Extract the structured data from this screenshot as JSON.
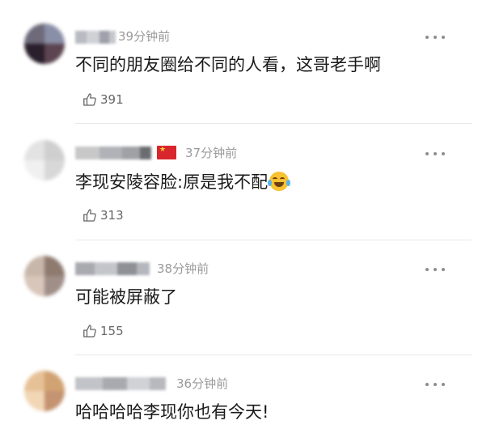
{
  "comments": [
    {
      "time": "39分钟前",
      "text": "不同的朋友圈给不同的人看，这哥老手啊",
      "likes": "391",
      "has_flag": false,
      "has_emoji": false,
      "avatar_colors": [
        "#6e6a7a",
        "#8a8fa8",
        "#2a1f2c",
        "#5c4550"
      ],
      "username_colors": [
        "#b9bbc2",
        "#cfd1d6",
        "#9ea1aa",
        "#c5c7cc"
      ]
    },
    {
      "time": "37分钟前",
      "text": "李现安陵容脸:原是我不配",
      "likes": "313",
      "has_flag": true,
      "has_emoji": true,
      "emoji_name": "tears-of-joy-emoji",
      "avatar_colors": [
        "#e3e3e3",
        "#cfcfcf",
        "#f0f0f0",
        "#d8d8d8"
      ],
      "username_colors": [
        "#c8c8c8",
        "#b0b2b8",
        "#9fa1a6",
        "#6a6c70"
      ]
    },
    {
      "time": "38分钟前",
      "text": "可能被屏蔽了",
      "likes": "155",
      "has_flag": false,
      "has_emoji": false,
      "avatar_colors": [
        "#c7b6aa",
        "#8f7a70",
        "#d8c6ba",
        "#a08f88"
      ],
      "username_colors": [
        "#a9aab0",
        "#c3c5ca",
        "#8e9096",
        "#b4b7bd"
      ]
    },
    {
      "time": "36分钟前",
      "text": "哈哈哈哈李现你也有今天!",
      "has_flag": false,
      "has_emoji": false,
      "avatar_colors": [
        "#e6c196",
        "#d1a272",
        "#f1d7b6",
        "#c49372"
      ],
      "username_colors": [
        "#c2c3c8",
        "#a9aab0",
        "#d0d2d6",
        "#b7b9be"
      ]
    }
  ],
  "colors": {
    "time_gray": "#9a9a9a",
    "text": "#1a1a1a",
    "like_gray": "#666666",
    "flag_red": "#d9262c",
    "flag_star": "#f6d13a"
  }
}
